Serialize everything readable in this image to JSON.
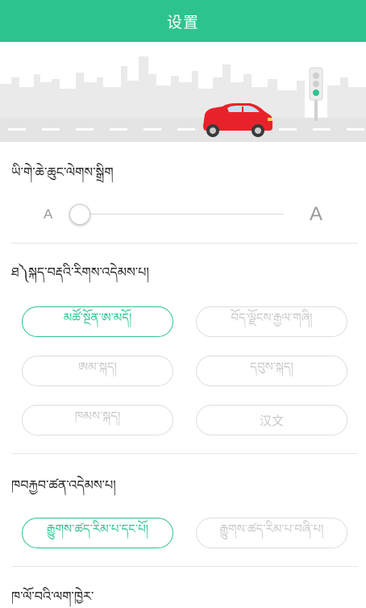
{
  "header": {
    "title": "设置"
  },
  "font_size": {
    "title": "ཡི་གེ་ཆེ་ཆུང་ལེགས་སྒྲིག",
    "small_label": "A",
    "large_label": "A",
    "level": 0
  },
  "voice_language": {
    "title": "ཐ༽སྐད་བརྡའི་རིགས་འདེམས་པ།",
    "options": [
      {
        "label": "མཚོ་སྔོན་ཨ་མདོ།",
        "selected": true
      },
      {
        "label": "བོད་ལྗོངས་རྒྱལ་གཞི།",
        "selected": false
      },
      {
        "label": "ཨམ་སྐད།",
        "selected": false
      },
      {
        "label": "དབུས་སྐད།",
        "selected": false
      },
      {
        "label": "ཁམས་སྐད།",
        "selected": false
      },
      {
        "label": "汉文",
        "selected": false
      }
    ]
  },
  "broadcast": {
    "title": "ཁབརྐྱབ་ཚན་འདེམས་པ།",
    "options": [
      {
        "label": "རྒྱུགས་ཚད་རིམ་པ་དང་པོ།",
        "selected": true
      },
      {
        "label": "རྒྱུགས་ཚད་རིམ་པ་བཞི་པ།",
        "selected": false
      }
    ]
  },
  "footer_section": {
    "title": "ཁ་ལོ་བའི་ལག་ཁྱེར་"
  },
  "colors": {
    "accent": "#2dc38e",
    "car": "#e8222a"
  }
}
